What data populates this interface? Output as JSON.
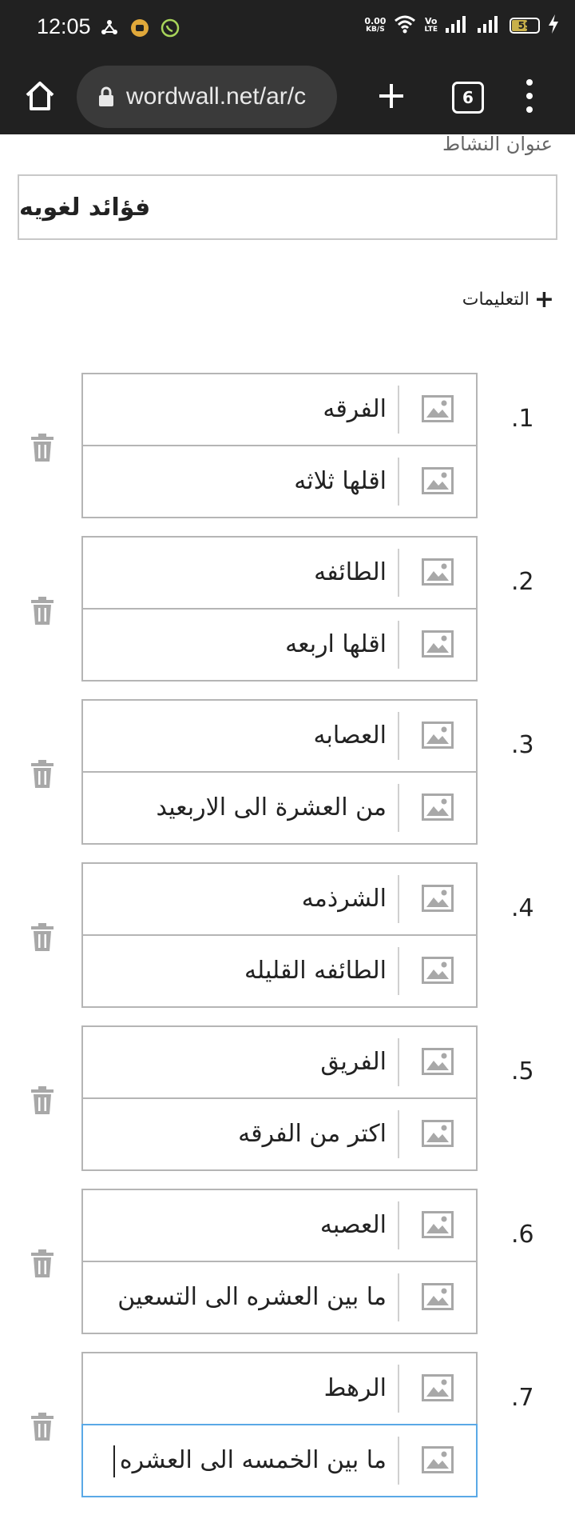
{
  "status": {
    "time": "12:05",
    "net_speed_value": "0.00",
    "net_speed_unit": "KB/S",
    "volte_top": "Vo",
    "volte_bottom": "LTE",
    "battery": "59"
  },
  "browser": {
    "url": "wordwall.net/ar/c",
    "tab_count": "6"
  },
  "form": {
    "activity_title_label": "عنوان النشاط",
    "activity_title_value": "فؤائد لغويه",
    "instructions_label": "التعليمات",
    "instructions_plus": "+"
  },
  "items": [
    {
      "num": ".1",
      "keyword": "الفرقه",
      "definition": "اقلها ثلاثه"
    },
    {
      "num": ".2",
      "keyword": "الطائفه",
      "definition": "اقلها اربعه"
    },
    {
      "num": ".3",
      "keyword": "العصابه",
      "definition": "من العشرة الى الاربعيد"
    },
    {
      "num": ".4",
      "keyword": "الشرذمه",
      "definition": "الطائفه القليله"
    },
    {
      "num": ".5",
      "keyword": "الفريق",
      "definition": "اكتر من الفرقه"
    },
    {
      "num": ".6",
      "keyword": "العصبه",
      "definition": "ما بين العشره الى التسعين"
    },
    {
      "num": ".7",
      "keyword": "الرهط",
      "definition": "ما بين الخمسه الى العشره"
    }
  ],
  "colors": {
    "toolbar_bg": "#212121",
    "url_bar_bg": "#3a3a3a",
    "field_border": "#b5b5b5",
    "active_border": "#5aa9e6",
    "icon_gray": "#a8a8a8"
  },
  "icons": [
    "home-icon",
    "lock-icon",
    "plus-icon",
    "tabs-icon",
    "more-vert-icon",
    "image-icon",
    "trash-icon",
    "wifi-icon",
    "signal-icon",
    "battery-icon",
    "whatsapp-icon"
  ]
}
